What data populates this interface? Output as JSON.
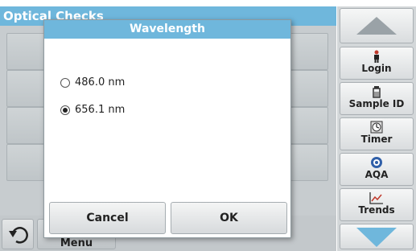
{
  "screen": {
    "title": "Optical Checks",
    "menu_label": "Menu"
  },
  "sidebar": {
    "items": [
      {
        "label": "Login",
        "icon": "person-icon"
      },
      {
        "label": "Sample ID",
        "icon": "sample-bottle-icon"
      },
      {
        "label": "Timer",
        "icon": "timer-icon"
      },
      {
        "label": "AQA",
        "icon": "aqa-icon"
      },
      {
        "label": "Trends",
        "icon": "trend-chart-icon"
      }
    ]
  },
  "dialog": {
    "title": "Wavelength",
    "options": [
      {
        "label": "486.0 nm",
        "selected": false
      },
      {
        "label": "656.1 nm",
        "selected": true
      }
    ],
    "cancel_label": "Cancel",
    "ok_label": "OK"
  },
  "colors": {
    "title_bar": "#6fb7dc",
    "arrow": "#6fb7dc",
    "arrow_up": "#9aa2a7"
  }
}
